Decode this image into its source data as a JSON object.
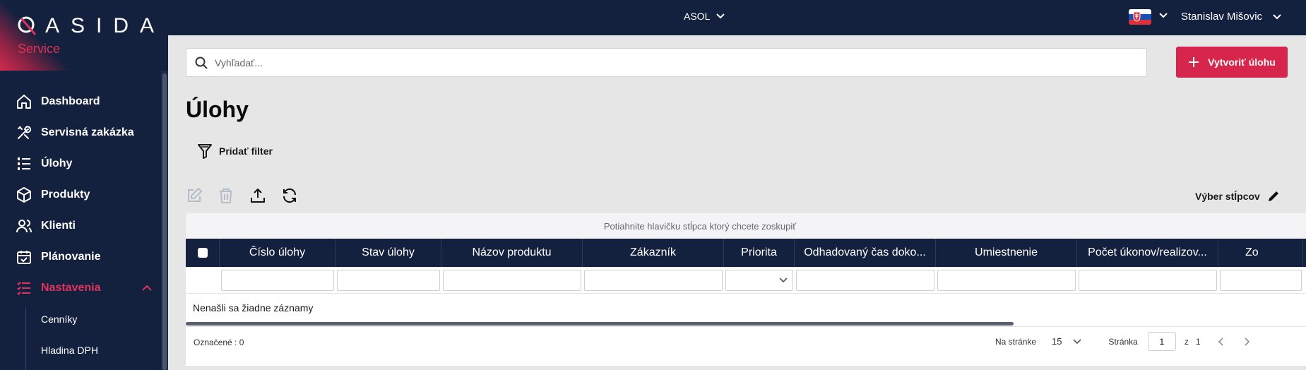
{
  "brand": {
    "logo_text": "ASIDA",
    "subtitle": "Service"
  },
  "header": {
    "company": "ASOL",
    "user_name": "Stanislav Mišovic",
    "language_flag": "flag-sk-icon"
  },
  "sidebar": {
    "items": [
      {
        "label": "Dashboard",
        "icon": "home-icon"
      },
      {
        "label": "Servisná zakázka",
        "icon": "tools-icon"
      },
      {
        "label": "Úlohy",
        "icon": "list-icon"
      },
      {
        "label": "Produkty",
        "icon": "box-icon"
      },
      {
        "label": "Klienti",
        "icon": "users-icon"
      },
      {
        "label": "Plánovanie",
        "icon": "calendar-icon"
      },
      {
        "label": "Nastavenia",
        "icon": "settings-list-icon",
        "active": true,
        "expanded": true
      }
    ],
    "subitems": [
      {
        "label": "Cenníky"
      },
      {
        "label": "Hladina DPH"
      }
    ]
  },
  "search": {
    "placeholder": "Vyhľadať..."
  },
  "actions": {
    "create_label": "Vytvoriť úlohu"
  },
  "page": {
    "title": "Úlohy",
    "add_filter": "Pridať filter",
    "column_select": "Výber stĺpcov"
  },
  "grid": {
    "group_hint": "Potiahnite hlavičku stĺpca ktorý chcete zoskupiť",
    "columns": [
      "Číslo úlohy",
      "Stav úlohy",
      "Názov produktu",
      "Zákazník",
      "Priorita",
      "Odhadovaný čas doko...",
      "Umiestnenie",
      "Počet úkonov/realizov...",
      "Zo"
    ],
    "empty_text": "Nenašli sa žiadne záznamy",
    "selected_label": "Označené : 0",
    "pager": {
      "per_page_label": "Na stránke",
      "per_page_value": "15",
      "page_label": "Stránka",
      "page_value": "1",
      "of_label": "z",
      "total_pages": "1"
    }
  },
  "colors": {
    "navy": "#13213f",
    "accent": "#d7264c",
    "background": "#e6e6e6"
  }
}
